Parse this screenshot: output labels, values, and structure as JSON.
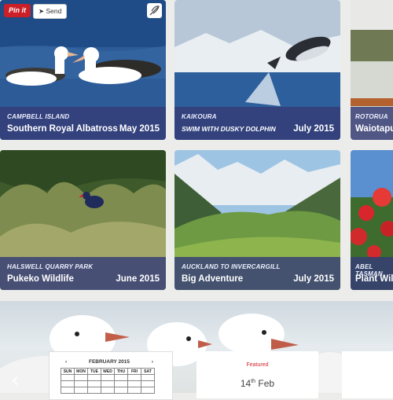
{
  "cards": [
    {
      "location": "CAMPBELL ISLAND",
      "title": "Southern Royal Albatross",
      "date": "May 2015"
    },
    {
      "location": "KAIKOURA",
      "title": "SWIM WITH DUSKY DOLPHIN",
      "date": "July 2015"
    },
    {
      "location": "ROTORUA",
      "title": "Waiotapu",
      "date": ""
    },
    {
      "location": "HALSWELL QUARRY PARK",
      "title": "Pukeko Wildlife",
      "date": "June 2015"
    },
    {
      "location": "AUCKLAND TO INVERCARGILL",
      "title": "Big Adventure",
      "date": "July 2015"
    },
    {
      "location": "ABEL TASMAN",
      "title": "Plant Wild",
      "date": ""
    }
  ],
  "share": {
    "pinit": "Pin it",
    "send": "Send"
  },
  "calendar": {
    "prev": "‹",
    "month": "FEBRUARY 2015",
    "next": "›",
    "days": [
      "SUN",
      "MON",
      "TUE",
      "WED",
      "THU",
      "FRI",
      "SAT"
    ]
  },
  "featured": {
    "label": "Featured",
    "date_day": "14",
    "date_suffix": "th",
    "date_month": "Feb"
  },
  "nav": {
    "prev_arrow": "‹"
  }
}
